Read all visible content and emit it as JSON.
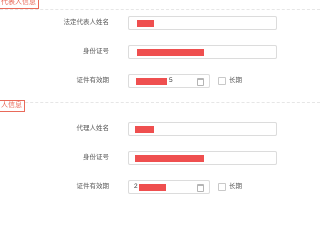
{
  "sections": {
    "legal_rep": {
      "title": "代表人信息",
      "name_label": "法定代表人姓名",
      "id_label": "身份证号",
      "validity_label": "证件有效期",
      "validity_suffix": "5",
      "long_term_label": "长期"
    },
    "agent": {
      "title": "人信息",
      "name_label": "代理人姓名",
      "id_label": "身份证号",
      "validity_label": "证件有效期",
      "validity_prefix": "2",
      "long_term_label": "长期"
    }
  },
  "colors": {
    "accent": "#e96a5a",
    "redaction": "#ef4f4f",
    "border": "#dcdcdc"
  }
}
